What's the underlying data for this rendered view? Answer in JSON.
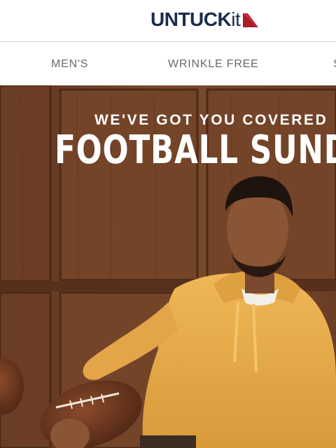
{
  "header": {
    "logo": {
      "brand": "UNTUCK",
      "suffix": "it",
      "icon": "triangle-flag-icon"
    }
  },
  "nav": {
    "items": [
      {
        "label": "MEN'S"
      },
      {
        "label": "WRINKLE FREE"
      },
      {
        "label": "S"
      }
    ]
  },
  "hero": {
    "eyebrow": "WE'VE GOT YOU COVERED",
    "headline": "FOOTBALL SUNDA"
  },
  "colors": {
    "brand_navy": "#1c2c4c",
    "brand_red": "#a81c2c",
    "nav_text": "#6a6a6a",
    "wood": "#6e4126",
    "hoodie": "#e8a94a"
  }
}
